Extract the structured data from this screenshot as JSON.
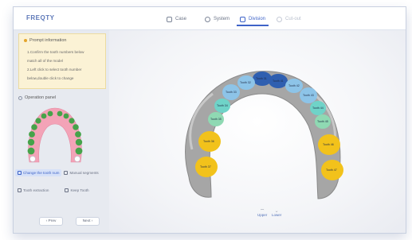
{
  "app": {
    "logo": "FREQTY"
  },
  "tabs": [
    {
      "label": "Case",
      "icon": "case-icon"
    },
    {
      "label": "System",
      "icon": "gear-icon"
    },
    {
      "label": "Division",
      "icon": "division-icon"
    },
    {
      "label": "Cut-out",
      "icon": "cutout-icon"
    }
  ],
  "prompt": {
    "title": "Prompt information",
    "lines": [
      "1.Confirm the tooth numbers below",
      "match all of the model",
      "2.Left click to select tooth number",
      "below,double click to change"
    ]
  },
  "operation": {
    "title": "Operation panel",
    "buttons": {
      "change": "Change the tooth num",
      "manual": "Manual segments",
      "extraction": "Tooth extraction",
      "keep": "Keep Tooth"
    }
  },
  "nav": {
    "prev": "Prev",
    "next": "Next"
  },
  "view_buttons": {
    "upper": "Upper",
    "lower": "Lower"
  },
  "teeth_labels": [
    "Tooth 31",
    "Tooth 41",
    "Tooth 32",
    "Tooth 42",
    "Tooth 33",
    "Tooth 43",
    "Tooth 34",
    "Tooth 44",
    "Tooth 35",
    "Tooth 45",
    "Tooth 36",
    "Tooth 46",
    "Tooth 37",
    "Tooth 47"
  ],
  "colors": {
    "accent": "#3e63c8",
    "incisor": "#2f5fb0",
    "lateral": "#8dc4e8",
    "canine": "#6fd3c8",
    "premolar": "#8fd9b3",
    "molar": "#f2c21b",
    "gum": "#a6a6a6",
    "map_gum": "#f3a3b7",
    "map_tooth": "#46a34a"
  }
}
